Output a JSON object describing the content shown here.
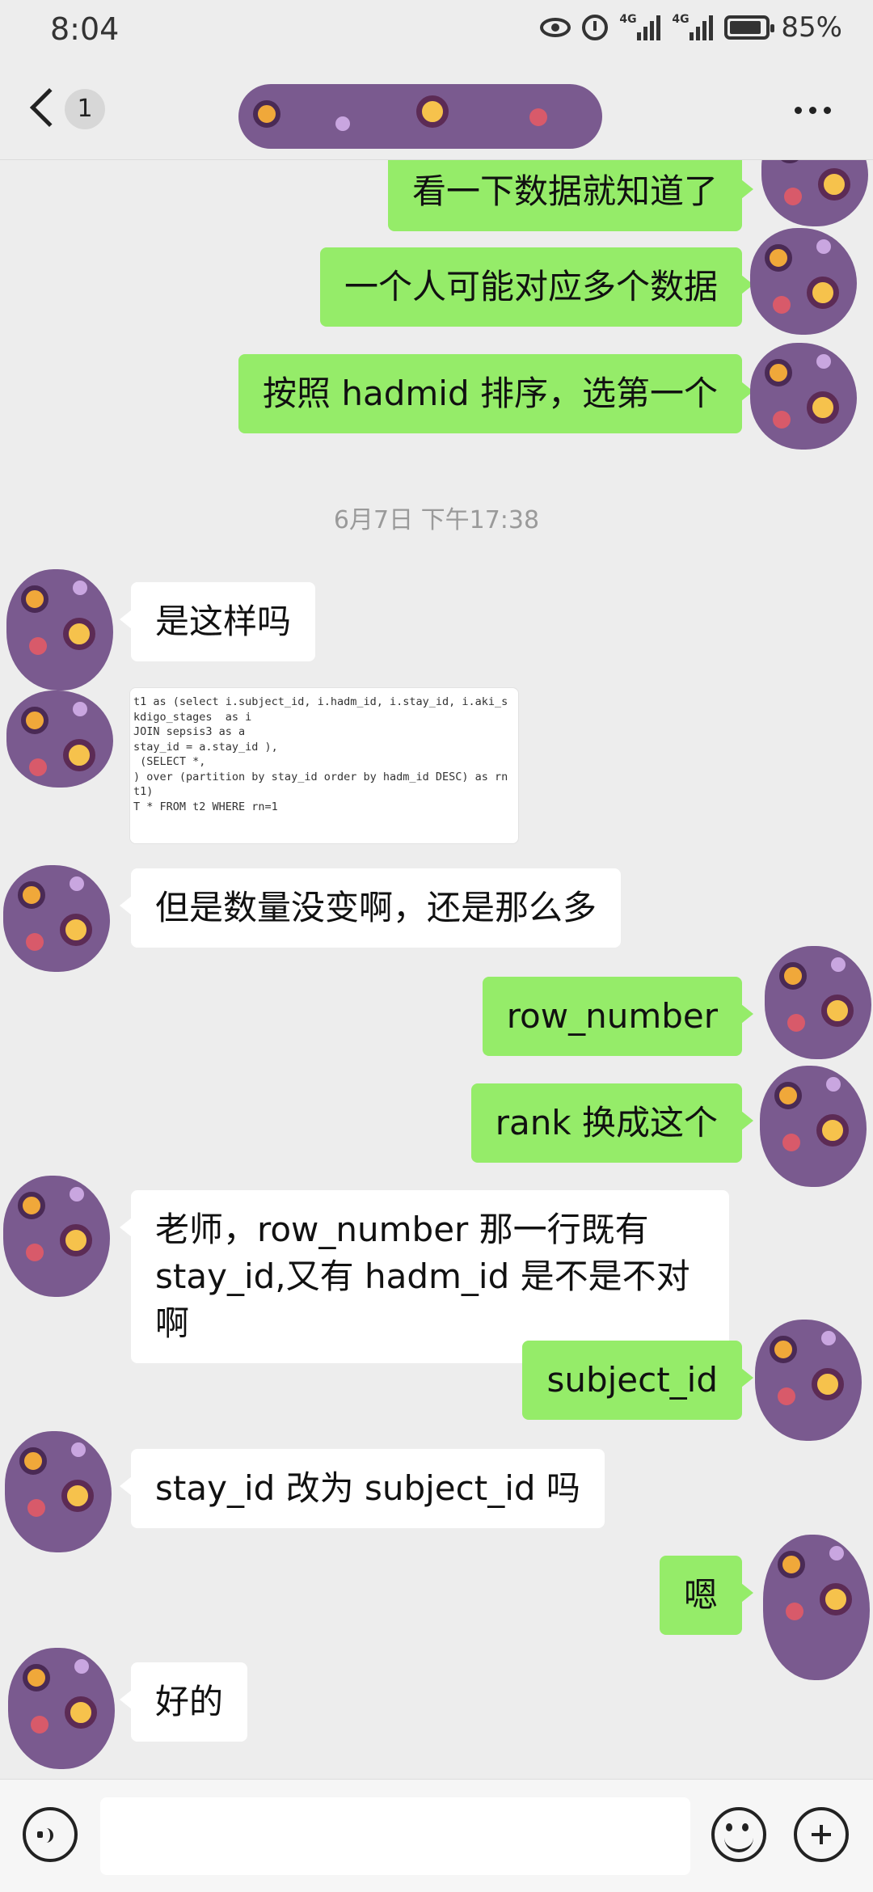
{
  "status_bar": {
    "time": "8:04",
    "battery": "85%",
    "network_1": "4G",
    "network_2": "4G"
  },
  "nav": {
    "back_icon": "chevron-left-icon",
    "unread_count": "1",
    "more_icon": "more-dots-icon"
  },
  "colors": {
    "background": "#ededed",
    "my_bubble": "#95ec69",
    "their_bubble": "#ffffff",
    "timestamp": "#9a9a9a"
  },
  "messages": [
    {
      "from": "me",
      "text": "看一下数据就知道了"
    },
    {
      "from": "me",
      "text": "一个人可能对应多个数据"
    },
    {
      "from": "me",
      "text": "按照 hadmid 排序，选第一个"
    },
    {
      "type": "timestamp",
      "text": "6月7日 下午17:38"
    },
    {
      "from": "them",
      "text": "是这样吗"
    },
    {
      "from": "them",
      "type": "image",
      "code_lines": [
        "t1 as (select i.subject_id, i.hadm_id, i.stay_id, i.aki_s",
        "kdigo_stages  as i",
        "JOIN sepsis3 as a",
        "stay_id = a.stay_id ),",
        " (SELECT *,",
        ") over (partition by stay_id order by hadm_id DESC) as rn",
        "t1)",
        "",
        "T * FROM t2 WHERE rn=1"
      ]
    },
    {
      "from": "them",
      "text": "但是数量没变啊，还是那么多"
    },
    {
      "from": "me",
      "text": "row_number"
    },
    {
      "from": "me",
      "text": "rank 换成这个"
    },
    {
      "from": "them",
      "text": "老师，row_number 那一行既有 stay_id,又有 hadm_id 是不是不对啊"
    },
    {
      "from": "me",
      "text": "subject_id"
    },
    {
      "from": "them",
      "text": "stay_id 改为 subject_id 吗"
    },
    {
      "from": "me",
      "text": "嗯"
    },
    {
      "from": "them",
      "text": "好的"
    }
  ],
  "input_bar": {
    "voice_icon": "voice-icon",
    "emoji_icon": "emoji-icon",
    "plus_icon": "plus-icon",
    "input_value": ""
  }
}
